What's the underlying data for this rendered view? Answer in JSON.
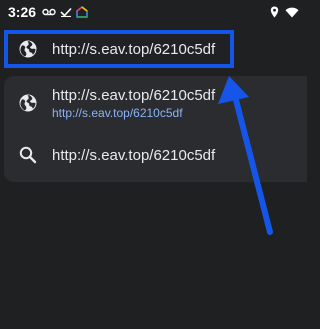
{
  "status_bar": {
    "time": "3:26"
  },
  "url_bar": {
    "text": "http://s.eav.top/6210c5df"
  },
  "suggestions": [
    {
      "title": "http://s.eav.top/6210c5df",
      "url": "http://s.eav.top/6210c5df",
      "icon": "globe-icon"
    },
    {
      "title": "http://s.eav.top/6210c5df",
      "icon": "search-icon"
    }
  ],
  "colors": {
    "highlight_border": "#1556e8",
    "link_url": "#8ab4f8",
    "background": "#1f2022",
    "panel": "#2b2c2f"
  }
}
